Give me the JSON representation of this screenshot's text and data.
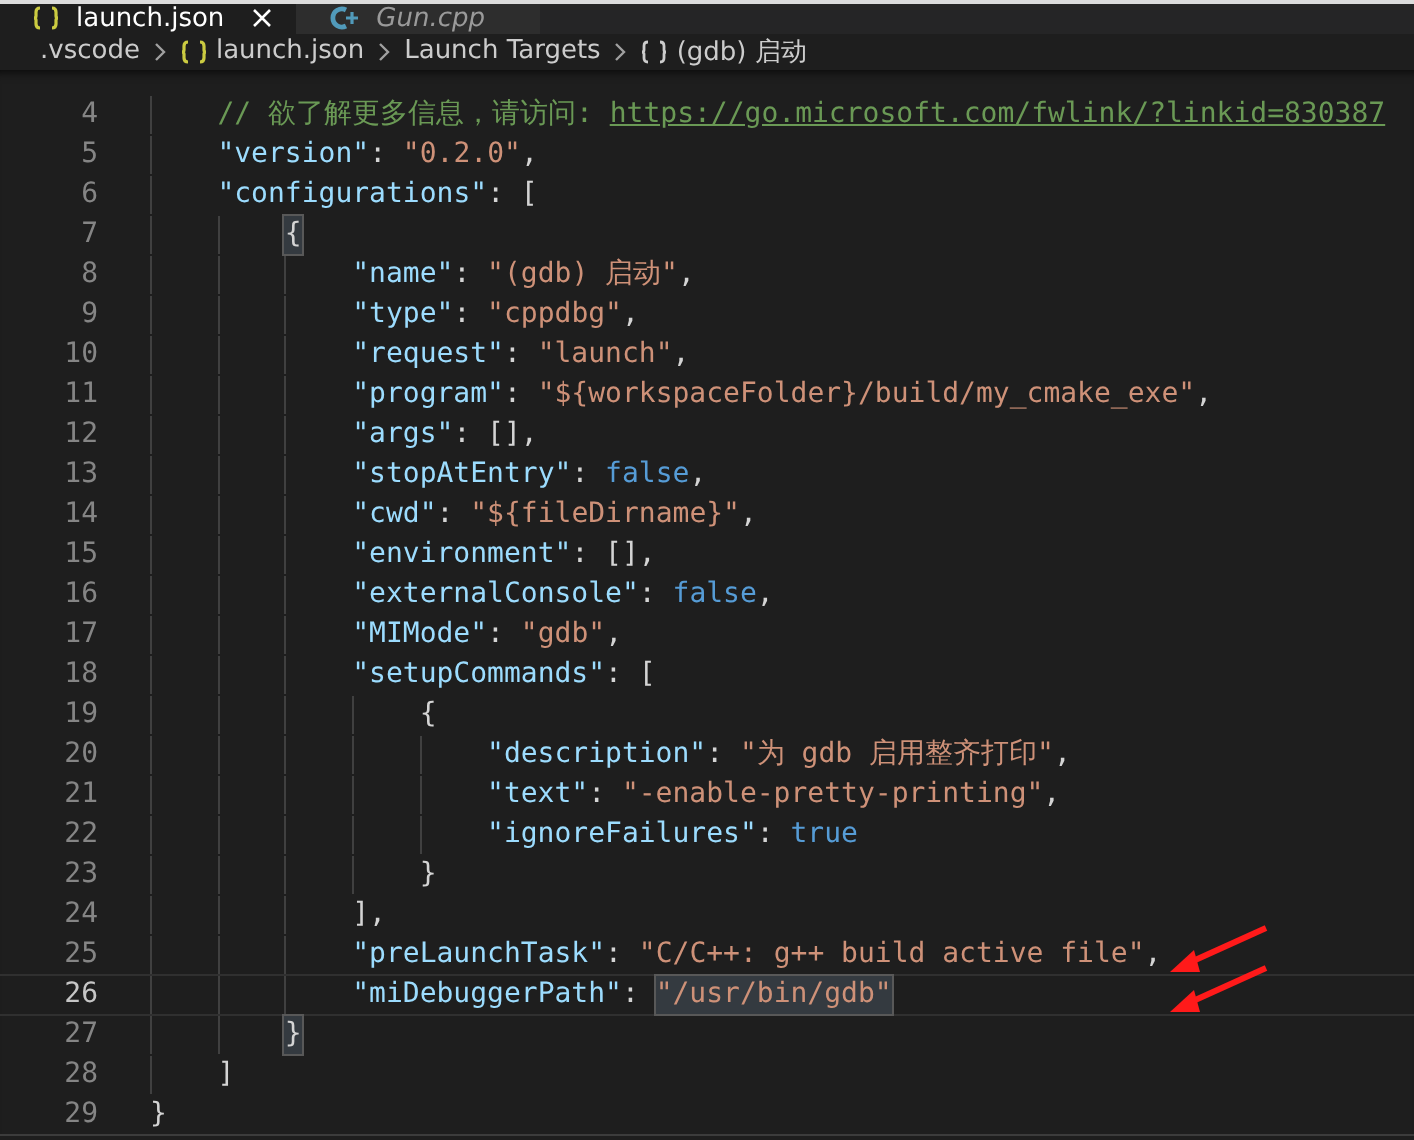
{
  "tabs": [
    {
      "label": "launch.json",
      "kind": "json",
      "selected": true,
      "italic": false,
      "closable": true
    },
    {
      "label": "Gun.cpp",
      "kind": "cpp",
      "selected": false,
      "italic": true,
      "closable": false
    }
  ],
  "breadcrumb": [
    {
      "label": ".vscode",
      "kind": "folder"
    },
    {
      "label": "launch.json",
      "kind": "json"
    },
    {
      "label": "Launch Targets",
      "kind": "folder"
    },
    {
      "label": "(gdb) 启动",
      "kind": "object"
    }
  ],
  "lines": [
    {
      "children": [
        {
          "number": "4",
          "current": false,
          "marked": false,
          "tokens": [
            {
              "kind": "comment",
              "text": "// 欲了解更多信息，请访问: "
            },
            {
              "kind": "link",
              "text": "https://go.microsoft.com/fwlink/?linkid=830387"
            }
          ]
        },
        {
          "number": "5",
          "current": false,
          "marked": false,
          "tokens": [
            {
              "kind": "key",
              "text": "\"version\""
            },
            {
              "kind": "punct",
              "text": ": "
            },
            {
              "kind": "string",
              "text": "\"0.2.0\""
            },
            {
              "kind": "punct",
              "text": ","
            }
          ]
        },
        {
          "number": "6",
          "current": false,
          "marked": false,
          "tokens": [
            {
              "kind": "key",
              "text": "\"configurations\""
            },
            {
              "kind": "punct",
              "text": ": ["
            }
          ],
          "children": [
            {
              "number": "7",
              "current": false,
              "marked": false,
              "tokens": [
                {
                  "kind": "punct",
                  "text": "{",
                  "highlighted": true
                }
              ],
              "children": [
                {
                  "number": "8",
                  "current": false,
                  "marked": false,
                  "tokens": [
                    {
                      "kind": "key",
                      "text": "\"name\""
                    },
                    {
                      "kind": "punct",
                      "text": ": "
                    },
                    {
                      "kind": "string",
                      "text": "\"(gdb) 启动\""
                    },
                    {
                      "kind": "punct",
                      "text": ","
                    }
                  ]
                },
                {
                  "number": "9",
                  "current": false,
                  "marked": false,
                  "tokens": [
                    {
                      "kind": "key",
                      "text": "\"type\""
                    },
                    {
                      "kind": "punct",
                      "text": ": "
                    },
                    {
                      "kind": "string",
                      "text": "\"cppdbg\""
                    },
                    {
                      "kind": "punct",
                      "text": ","
                    }
                  ]
                },
                {
                  "number": "10",
                  "current": false,
                  "marked": false,
                  "tokens": [
                    {
                      "kind": "key",
                      "text": "\"request\""
                    },
                    {
                      "kind": "punct",
                      "text": ": "
                    },
                    {
                      "kind": "string",
                      "text": "\"launch\""
                    },
                    {
                      "kind": "punct",
                      "text": ","
                    }
                  ]
                },
                {
                  "number": "11",
                  "current": false,
                  "marked": false,
                  "tokens": [
                    {
                      "kind": "key",
                      "text": "\"program\""
                    },
                    {
                      "kind": "punct",
                      "text": ": "
                    },
                    {
                      "kind": "string",
                      "text": "\"${workspaceFolder}/build/my_cmake_exe\""
                    },
                    {
                      "kind": "punct",
                      "text": ","
                    }
                  ]
                },
                {
                  "number": "12",
                  "current": false,
                  "marked": false,
                  "tokens": [
                    {
                      "kind": "key",
                      "text": "\"args\""
                    },
                    {
                      "kind": "punct",
                      "text": ": [],"
                    }
                  ]
                },
                {
                  "number": "13",
                  "current": false,
                  "marked": false,
                  "tokens": [
                    {
                      "kind": "key",
                      "text": "\"stopAtEntry\""
                    },
                    {
                      "kind": "punct",
                      "text": ": "
                    },
                    {
                      "kind": "keyword",
                      "text": "false"
                    },
                    {
                      "kind": "punct",
                      "text": ","
                    }
                  ]
                },
                {
                  "number": "14",
                  "current": false,
                  "marked": false,
                  "tokens": [
                    {
                      "kind": "key",
                      "text": "\"cwd\""
                    },
                    {
                      "kind": "punct",
                      "text": ": "
                    },
                    {
                      "kind": "string",
                      "text": "\"${fileDirname}\""
                    },
                    {
                      "kind": "punct",
                      "text": ","
                    }
                  ]
                },
                {
                  "number": "15",
                  "current": false,
                  "marked": false,
                  "tokens": [
                    {
                      "kind": "key",
                      "text": "\"environment\""
                    },
                    {
                      "kind": "punct",
                      "text": ": [],"
                    }
                  ]
                },
                {
                  "number": "16",
                  "current": false,
                  "marked": false,
                  "tokens": [
                    {
                      "kind": "key",
                      "text": "\"externalConsole\""
                    },
                    {
                      "kind": "punct",
                      "text": ": "
                    },
                    {
                      "kind": "keyword",
                      "text": "false"
                    },
                    {
                      "kind": "punct",
                      "text": ","
                    }
                  ]
                },
                {
                  "number": "17",
                  "current": false,
                  "marked": false,
                  "tokens": [
                    {
                      "kind": "key",
                      "text": "\"MIMode\""
                    },
                    {
                      "kind": "punct",
                      "text": ": "
                    },
                    {
                      "kind": "string",
                      "text": "\"gdb\""
                    },
                    {
                      "kind": "punct",
                      "text": ","
                    }
                  ]
                },
                {
                  "number": "18",
                  "current": false,
                  "marked": false,
                  "tokens": [
                    {
                      "kind": "key",
                      "text": "\"setupCommands\""
                    },
                    {
                      "kind": "punct",
                      "text": ": ["
                    }
                  ],
                  "children": [
                    {
                      "number": "19",
                      "current": false,
                      "marked": false,
                      "tokens": [
                        {
                          "kind": "punct",
                          "text": "{"
                        }
                      ],
                      "children": [
                        {
                          "number": "20",
                          "current": false,
                          "marked": false,
                          "tokens": [
                            {
                              "kind": "key",
                              "text": "\"description\""
                            },
                            {
                              "kind": "punct",
                              "text": ": "
                            },
                            {
                              "kind": "string",
                              "text": "\"为 gdb 启用整齐打印\""
                            },
                            {
                              "kind": "punct",
                              "text": ","
                            }
                          ]
                        },
                        {
                          "number": "21",
                          "current": false,
                          "marked": false,
                          "tokens": [
                            {
                              "kind": "key",
                              "text": "\"text\""
                            },
                            {
                              "kind": "punct",
                              "text": ": "
                            },
                            {
                              "kind": "string",
                              "text": "\"-enable-pretty-printing\""
                            },
                            {
                              "kind": "punct",
                              "text": ","
                            }
                          ]
                        },
                        {
                          "number": "22",
                          "current": false,
                          "marked": false,
                          "tokens": [
                            {
                              "kind": "key",
                              "text": "\"ignoreFailures\""
                            },
                            {
                              "kind": "punct",
                              "text": ": "
                            },
                            {
                              "kind": "keyword",
                              "text": "true"
                            }
                          ]
                        }
                      ]
                    },
                    {
                      "number": "23",
                      "current": false,
                      "marked": false,
                      "tokens": [
                        {
                          "kind": "punct",
                          "text": "}"
                        }
                      ]
                    }
                  ]
                },
                {
                  "number": "24",
                  "current": false,
                  "marked": false,
                  "tokens": [
                    {
                      "kind": "punct",
                      "text": "],"
                    }
                  ]
                },
                {
                  "number": "25",
                  "current": false,
                  "marked": true,
                  "tokens": [
                    {
                      "kind": "key",
                      "text": "\"preLaunchTask\""
                    },
                    {
                      "kind": "punct",
                      "text": ": "
                    },
                    {
                      "kind": "string",
                      "text": "\"C/C++: g++ build active file\""
                    },
                    {
                      "kind": "punct",
                      "text": ","
                    }
                  ]
                },
                {
                  "number": "26",
                  "current": true,
                  "marked": true,
                  "tokens": [
                    {
                      "kind": "key",
                      "text": "\"miDebuggerPath\""
                    },
                    {
                      "kind": "punct",
                      "text": ": "
                    },
                    {
                      "kind": "string",
                      "text": "\"/usr/bin/gdb\"",
                      "highlighted": true
                    }
                  ]
                }
              ]
            },
            {
              "number": "27",
              "current": false,
              "marked": false,
              "tokens": [
                {
                  "kind": "punct",
                  "text": "}",
                  "highlighted": true
                }
              ]
            }
          ]
        },
        {
          "number": "28",
          "current": false,
          "marked": false,
          "tokens": [
            {
              "kind": "punct",
              "text": "]"
            }
          ]
        }
      ]
    },
    {
      "number": "29",
      "current": false,
      "marked": false,
      "tokens": [
        {
          "kind": "punct",
          "text": "}"
        }
      ]
    }
  ]
}
